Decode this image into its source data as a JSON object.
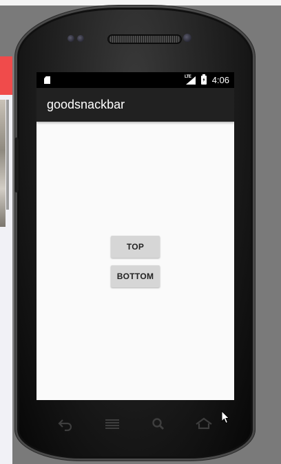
{
  "app": {
    "title": "goodsnackbar"
  },
  "status_bar": {
    "time": "4:06",
    "network_label": "LTE",
    "icons": [
      "sd-card-icon",
      "lte-signal-icon",
      "battery-charging-icon"
    ]
  },
  "buttons": {
    "top_label": "TOP",
    "bottom_label": "BOTTOM"
  },
  "nav_bar": {
    "icons": [
      "back-icon",
      "menu-icon",
      "search-icon",
      "home-icon"
    ]
  },
  "colors": {
    "app_bar": "#212121",
    "status_bar": "#000000",
    "screen_background": "#fafafa",
    "button_background": "#d6d6d6",
    "accent_red": "#f04b4b"
  }
}
